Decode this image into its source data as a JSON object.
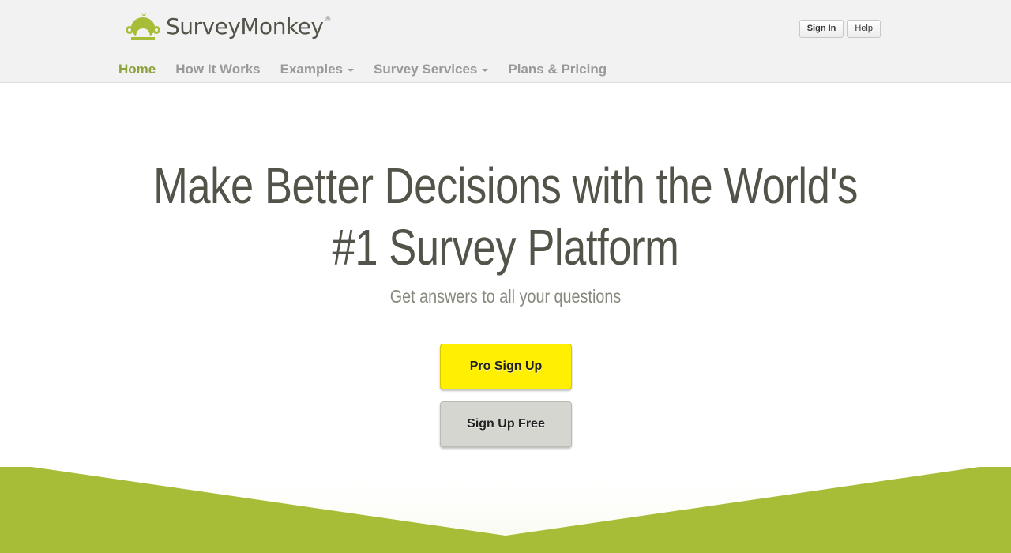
{
  "header": {
    "logo_text": "SurveyMonkey",
    "logo_reg": "®",
    "sign_in_label": "Sign In",
    "help_label": "Help"
  },
  "nav": {
    "items": [
      {
        "label": "Home",
        "active": true
      },
      {
        "label": "How It Works"
      },
      {
        "label": "Examples",
        "dropdown": true
      },
      {
        "label": "Survey Services",
        "dropdown": true
      },
      {
        "label": "Plans & Pricing"
      }
    ]
  },
  "hero": {
    "title_line1": "Make Better Decisions with the World's",
    "title_line2": "#1 Survey Platform",
    "subtitle": "Get answers to all your questions",
    "pro_button": "Pro Sign Up",
    "free_button": "Sign Up Free"
  },
  "colors": {
    "brand_green": "#a8bd37",
    "nav_active": "#8aa33b",
    "pro_yellow": "#ffef00",
    "free_gray": "#d5d6cf",
    "heading": "#535349"
  },
  "icons": {
    "logo": "monkey-logo-icon",
    "dropdown": "caret-down-icon"
  }
}
